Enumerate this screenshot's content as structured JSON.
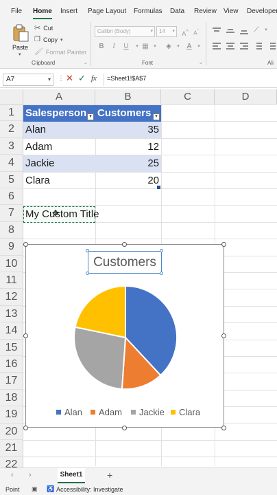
{
  "ribbon": {
    "tabs": [
      "File",
      "Home",
      "Insert",
      "Page Layout",
      "Formulas",
      "Data",
      "Review",
      "View",
      "Developer"
    ],
    "active_tab": "Home",
    "clipboard": {
      "paste": "Paste",
      "cut": "Cut",
      "copy": "Copy",
      "format_painter": "Format Painter",
      "group_label": "Clipboard"
    },
    "font": {
      "family": "Calibri (Body)",
      "size": "14",
      "group_label": "Font",
      "bold": "B",
      "italic": "I",
      "underline": "U"
    },
    "alignment": {
      "group_label": "Ali"
    }
  },
  "formula_bar": {
    "name_box": "A7",
    "fx": "fx",
    "formula": "=Sheet1!$A$7"
  },
  "columns": [
    "A",
    "B",
    "C",
    "D"
  ],
  "rows": [
    "1",
    "2",
    "3",
    "4",
    "5",
    "6",
    "7",
    "8",
    "9",
    "10",
    "11",
    "12",
    "13",
    "14",
    "15",
    "16",
    "17",
    "18",
    "19",
    "20",
    "21",
    "22"
  ],
  "table": {
    "headers": [
      "Salesperson",
      "Customers"
    ],
    "rows": [
      {
        "name": "Alan",
        "value": "35"
      },
      {
        "name": "Adam",
        "value": "12"
      },
      {
        "name": "Jackie",
        "value": "25"
      },
      {
        "name": "Clara",
        "value": "20"
      }
    ]
  },
  "cell_a7": "My Custom Title",
  "chart_data": {
    "type": "pie",
    "title": "Customers",
    "categories": [
      "Alan",
      "Adam",
      "Jackie",
      "Clara"
    ],
    "values": [
      35,
      12,
      25,
      20
    ],
    "colors": [
      "#4472c4",
      "#ed7d31",
      "#a5a5a5",
      "#ffc000"
    ],
    "legend": "bottom"
  },
  "sheets": {
    "active": "Sheet1",
    "add": "+"
  },
  "status": {
    "mode": "Point",
    "accessibility": "Accessibility: Investigate"
  }
}
